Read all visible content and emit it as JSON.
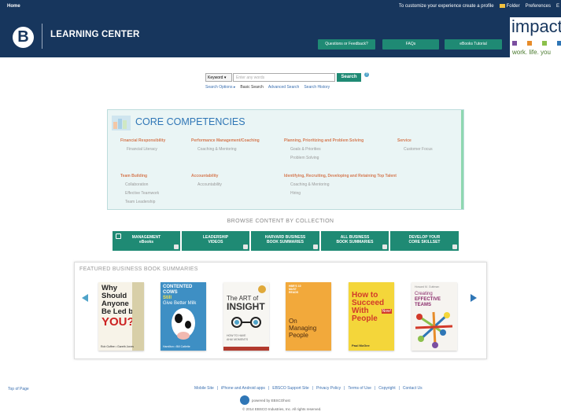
{
  "topbar": {
    "home": "Home",
    "profile_text": "To customize your experience create a profile",
    "folder": "Folder",
    "preferences": "Preferences",
    "e_link": "E"
  },
  "header": {
    "logo": "B",
    "title": "LEARNING CENTER",
    "buttons": [
      "Questions or Feedback?",
      "FAQs",
      "eBooks Tutorial"
    ],
    "impact": "impact",
    "impact_tagline": "work. life. you",
    "impact_colors": [
      "#7b4ea0",
      "#e78c2a",
      "#8cc04b",
      "#2f76b6"
    ]
  },
  "search": {
    "scope": "Keyword",
    "placeholder": "Enter any words",
    "button": "Search",
    "help": "?",
    "options": "Search Options ▸",
    "basic": "Basic Search",
    "advanced": "Advanced Search",
    "history": "Search History"
  },
  "core": {
    "title": "CORE COMPETENCIES",
    "financial": {
      "title": "Financial Responsibility",
      "items": [
        "Financial Literacy"
      ]
    },
    "performance": {
      "title": "Performance Management/Coaching",
      "items": [
        "Coaching & Mentoring"
      ]
    },
    "planning": {
      "title": "Planning, Prioritizing and Problem Solving",
      "items": [
        "Goals & Priorities",
        "Problem Solving"
      ]
    },
    "service": {
      "title": "Service",
      "items": [
        "Customer Focus"
      ]
    },
    "team": {
      "title": "Team Building",
      "items": [
        "Collaboration",
        "Effective Teamwork",
        "Team Leadership"
      ]
    },
    "accountability": {
      "title": "Accountability",
      "items": [
        "Accountability"
      ]
    },
    "talent": {
      "title": "Identifying, Recruiting, Developing and Retaining Top Talent",
      "items": [
        "Coaching & Mentoring",
        "Hiring"
      ]
    }
  },
  "browse": {
    "title": "BROWSE CONTENT BY COLLECTION",
    "collections": [
      [
        "MANAGEMENT",
        "eBooks"
      ],
      [
        "LEADERSHIP",
        "VIDEOS"
      ],
      [
        "HARVARD BUSINESS",
        "BOOK SUMMARIES"
      ],
      [
        "ALL BUSINESS",
        "BOOK SUMMARIES"
      ],
      [
        "DEVELOP YOUR",
        "CORE SKILLSET"
      ]
    ]
  },
  "featured": {
    "title": "FEATURED BUSINESS BOOK SUMMARIES",
    "books": [
      {
        "title_lines": [
          "Why",
          "Should",
          "Anyone",
          "Be Led by"
        ],
        "big": "YOU?",
        "authors": "Rob Goffee • Gareth Jones"
      },
      {
        "title_lines": [
          "CONTENTED COWS",
          "Still",
          "Give Better Milk"
        ],
        "authors": "Hamilton • Bill Catlette"
      },
      {
        "title_lines": [
          "The ART of",
          "INSIGHT"
        ],
        "sub": "HOW TO HAVE",
        "sub2": "AHA! MOMENTS"
      },
      {
        "top": "HBR'S 10 MUST READS",
        "title_lines": [
          "On",
          "Managing",
          "People"
        ]
      },
      {
        "title_lines": [
          "How to",
          "Succeed",
          "With",
          "People"
        ],
        "badge": "Now!",
        "authors": "Paul McGee"
      },
      {
        "top": "Howard M. Guttman",
        "title_lines": [
          "Creating",
          "EFFECTIVE TEAMS"
        ]
      }
    ]
  },
  "footer": {
    "top_of_page": "Top of Page",
    "links": [
      "Mobile Site",
      "iPhone and Android apps",
      "EBSCO Support Site",
      "Privacy Policy",
      "Terms of Use",
      "Copyright",
      "Contact Us"
    ],
    "powered": "powered by EBSCOhost",
    "copyright": "© 2014 EBSCO Industries, Inc. All rights reserved."
  }
}
